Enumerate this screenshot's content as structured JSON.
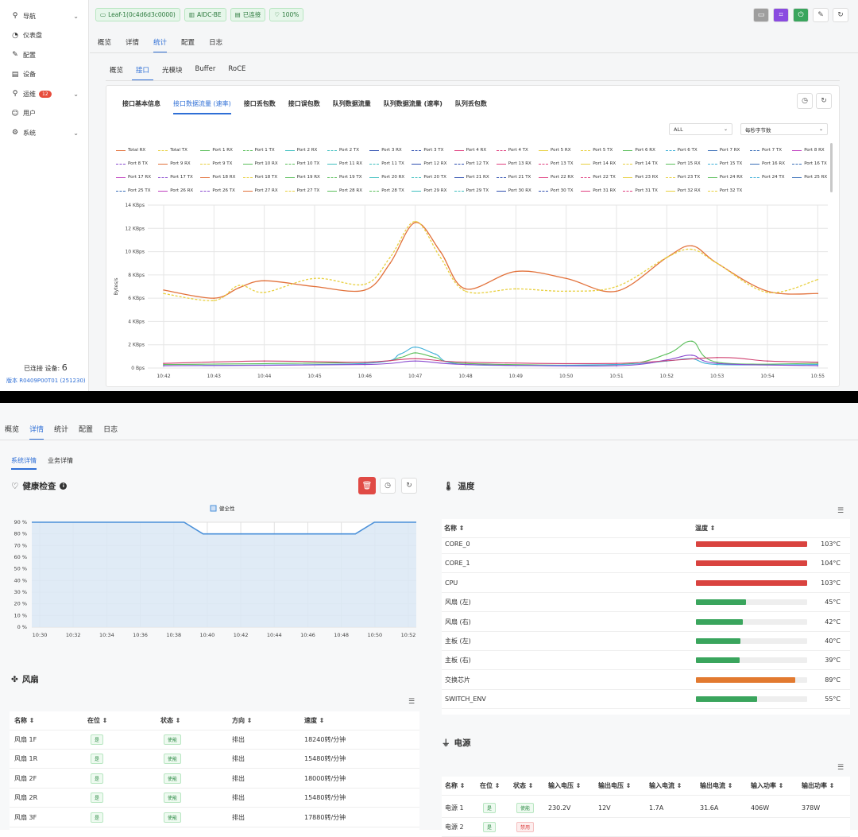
{
  "sidebar": {
    "items": [
      {
        "label": "导航",
        "icon": "navigation-icon",
        "chev": "⌄"
      },
      {
        "label": "仪表盘",
        "icon": "dashboard-icon",
        "chev": ""
      },
      {
        "label": "配置",
        "icon": "wrench-icon",
        "chev": ""
      },
      {
        "label": "设备",
        "icon": "device-icon",
        "chev": ""
      },
      {
        "label": "运维",
        "icon": "search-icon",
        "chev": "⌄",
        "badge": "12"
      },
      {
        "label": "用户",
        "icon": "users-icon",
        "chev": ""
      },
      {
        "label": "系统",
        "icon": "gear-icon",
        "chev": "⌄"
      }
    ],
    "connected_label": "已连接 设备:",
    "connected_count": "6",
    "version": "版本 R0409P00T01 (251230)"
  },
  "header": {
    "pills": [
      "Leaf-1(0c4d6d3c0000)",
      "AIDC-BE",
      "已连接",
      "100%"
    ],
    "colors": {
      "pill_bg": "#e6f6ea",
      "accent": "#2f6fd6"
    }
  },
  "tabs_main": [
    "概览",
    "详情",
    "统计",
    "配置",
    "日志"
  ],
  "tabs_main_active": 2,
  "tabs_sub": [
    "概览",
    "接口",
    "光模块",
    "Buffer",
    "RoCE"
  ],
  "tabs_sub_active": 1,
  "tabs_stats": [
    "接口基本信息",
    "接口数据流量 (速率)",
    "接口丢包数",
    "接口误包数",
    "队列数据流量",
    "队列数据流量 (速率)",
    "队列丢包数"
  ],
  "tabs_stats_active": 1,
  "filters": {
    "port": "ALL",
    "unit": "每秒字节数"
  },
  "chart_data": {
    "type": "line",
    "ylabel": "Bytes/s",
    "yticks": [
      "0 Bps",
      "2 KBps",
      "4 KBps",
      "6 KBps",
      "8 KBps",
      "10 KBps",
      "12 KBps",
      "14 KBps"
    ],
    "ylim": [
      0,
      14
    ],
    "xticks": [
      "10:42",
      "10:43",
      "10:44",
      "10:45",
      "10:46",
      "10:47",
      "10:48",
      "10:49",
      "10:50",
      "10:51",
      "10:52",
      "10:53",
      "10:54",
      "10:55"
    ],
    "legend": [
      "Total RX",
      "Total TX",
      "Port 1 RX",
      "Port 1 TX",
      "Port 2 RX",
      "Port 2 TX",
      "Port 3 RX",
      "Port 3 TX",
      "Port 4 RX",
      "Port 4 TX",
      "Port 5 RX",
      "Port 5 TX",
      "Port 6 RX",
      "Port 6 TX",
      "Port 7 RX",
      "Port 7 TX",
      "Port 8 RX",
      "Port 8 TX",
      "Port 9 RX",
      "Port 9 TX",
      "Port 10 RX",
      "Port 10 TX",
      "Port 11 RX",
      "Port 11 TX",
      "Port 12 RX",
      "Port 12 TX",
      "Port 13 RX",
      "Port 13 TX",
      "Port 14 RX",
      "Port 14 TX",
      "Port 15 RX",
      "Port 15 TX",
      "Port 16 RX",
      "Port 16 TX",
      "Port 17 RX",
      "Port 17 TX",
      "Port 18 RX",
      "Port 18 TX",
      "Port 19 RX",
      "Port 19 TX",
      "Port 20 RX",
      "Port 20 TX",
      "Port 21 RX",
      "Port 21 TX",
      "Port 22 RX",
      "Port 22 TX",
      "Port 23 RX",
      "Port 23 TX",
      "Port 24 RX",
      "Port 24 TX",
      "Port 25 RX",
      "Port 25 TX",
      "Port 26 RX",
      "Port 26 TX",
      "Port 27 RX",
      "Port 27 TX",
      "Port 28 RX",
      "Port 28 TX",
      "Port 29 RX",
      "Port 29 TX",
      "Port 30 RX",
      "Port 30 TX",
      "Port 31 RX",
      "Port 31 TX",
      "Port 32 RX",
      "Port 32 TX"
    ],
    "series": [
      {
        "name": "Total RX",
        "color": "#e2713a",
        "x": [
          0,
          1,
          1.5,
          2,
          3,
          4,
          4.5,
          5,
          5.5,
          6,
          7,
          8,
          9,
          10,
          10.5,
          11,
          12,
          13
        ],
        "values": [
          6.7,
          6.0,
          6.9,
          7.5,
          7.0,
          6.7,
          9.0,
          12.5,
          10.0,
          6.8,
          8.3,
          7.7,
          6.6,
          9.5,
          10.5,
          9.0,
          6.6,
          6.4
        ]
      },
      {
        "name": "Total TX",
        "color": "#e8d040",
        "dash": true,
        "x": [
          0,
          1,
          1.5,
          2,
          3,
          4,
          4.5,
          5,
          5.5,
          6,
          7,
          8,
          9,
          10,
          10.5,
          11,
          12,
          13
        ],
        "values": [
          6.4,
          5.8,
          7.1,
          6.5,
          7.7,
          7.2,
          9.5,
          12.6,
          9.5,
          6.6,
          6.8,
          6.6,
          7.0,
          9.5,
          10.2,
          9.0,
          6.5,
          7.6
        ]
      },
      {
        "name": "Port 1 RX",
        "color": "#5bbf5b",
        "x": [
          0,
          4,
          4.7,
          5,
          5.4,
          6,
          9,
          10,
          10.5,
          11,
          13
        ],
        "values": [
          0.3,
          0.5,
          0.9,
          1.3,
          0.9,
          0.4,
          0.3,
          1.2,
          2.3,
          0.5,
          0.4
        ]
      },
      {
        "name": "Port 2 RX",
        "color": "#3fb0d8",
        "x": [
          0,
          4,
          4.7,
          5,
          5.4,
          6,
          9,
          10,
          10.5,
          11,
          13
        ],
        "values": [
          0.2,
          0.4,
          1.2,
          1.8,
          1.2,
          0.3,
          0.3,
          0.6,
          0.8,
          0.3,
          0.3
        ]
      },
      {
        "name": "Port 3 RX",
        "color": "#8a4bd0",
        "x": [
          0,
          4,
          5,
          6,
          9,
          10,
          10.5,
          11,
          13
        ],
        "values": [
          0.2,
          0.3,
          0.6,
          0.3,
          0.2,
          0.7,
          1.1,
          0.4,
          0.2
        ]
      },
      {
        "name": "Port 4 RX",
        "color": "#d04070",
        "x": [
          0,
          2,
          4,
          5,
          6,
          9,
          11,
          12,
          13
        ],
        "values": [
          0.4,
          0.6,
          0.5,
          0.8,
          0.5,
          0.4,
          0.9,
          0.6,
          0.5
        ]
      }
    ]
  },
  "bottom_tabs": [
    "概览",
    "详情",
    "统计",
    "配置",
    "日志"
  ],
  "bottom_tabs_active": 1,
  "bottom_subtabs": [
    "系统详情",
    "业务详情"
  ],
  "health": {
    "title": "健康检查",
    "legend": "健全性",
    "yticks": [
      "0 %",
      "10 %",
      "20 %",
      "30 %",
      "40 %",
      "50 %",
      "60 %",
      "70 %",
      "80 %",
      "90 %"
    ],
    "xticks": [
      "10:30",
      "10:32",
      "10:34",
      "10:36",
      "10:38",
      "10:40",
      "10:42",
      "10:44",
      "10:46",
      "10:48",
      "10:50",
      "10:52"
    ],
    "x": [
      0,
      8,
      9,
      17,
      18,
      20.2
    ],
    "values": [
      90,
      90,
      80,
      80,
      90,
      90
    ]
  },
  "temperature": {
    "title": "温度",
    "col_name": "名称",
    "col_temp": "温度",
    "rows": [
      {
        "name": "CORE_0",
        "value": "103°C",
        "pct": 100,
        "color": "#d9433f"
      },
      {
        "name": "CORE_1",
        "value": "104°C",
        "pct": 100,
        "color": "#d9433f"
      },
      {
        "name": "CPU",
        "value": "103°C",
        "pct": 100,
        "color": "#d9433f"
      },
      {
        "name": "风扇 (左)",
        "value": "45°C",
        "pct": 45,
        "color": "#3aa55d"
      },
      {
        "name": "风扇 (右)",
        "value": "42°C",
        "pct": 42,
        "color": "#3aa55d"
      },
      {
        "name": "主板 (左)",
        "value": "40°C",
        "pct": 40,
        "color": "#3aa55d"
      },
      {
        "name": "主板 (右)",
        "value": "39°C",
        "pct": 39,
        "color": "#3aa55d"
      },
      {
        "name": "交换芯片",
        "value": "89°C",
        "pct": 89,
        "color": "#e27a30"
      },
      {
        "name": "SWITCH_ENV",
        "value": "55°C",
        "pct": 55,
        "color": "#3aa55d"
      }
    ]
  },
  "fans": {
    "title": "风扇",
    "cols": [
      "名称",
      "在位",
      "状态",
      "方向",
      "速度"
    ],
    "rows": [
      [
        "风扇 1F",
        "是",
        "使能",
        "排出",
        "18240转/分钟"
      ],
      [
        "风扇 1R",
        "是",
        "使能",
        "排出",
        "15480转/分钟"
      ],
      [
        "风扇 2F",
        "是",
        "使能",
        "排出",
        "18000转/分钟"
      ],
      [
        "风扇 2R",
        "是",
        "使能",
        "排出",
        "15480转/分钟"
      ],
      [
        "风扇 3F",
        "是",
        "使能",
        "排出",
        "17880转/分钟"
      ]
    ]
  },
  "power": {
    "title": "电源",
    "cols": [
      "名称",
      "在位",
      "状态",
      "输入电压",
      "输出电压",
      "输入电流",
      "输出电流",
      "输入功率",
      "输出功率"
    ],
    "rows": [
      [
        "电源 1",
        "是",
        "使能",
        "230.2V",
        "12V",
        "1.7A",
        "31.6A",
        "406W",
        "378W"
      ],
      [
        "电源 2",
        "是",
        "禁用",
        "",
        "",
        "",
        "",
        "",
        ""
      ]
    ]
  }
}
